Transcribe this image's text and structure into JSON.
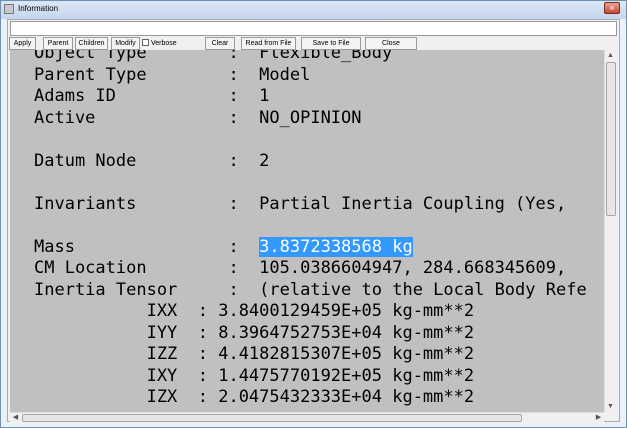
{
  "window": {
    "title": "Information",
    "close_glyph": "×"
  },
  "toolbar": {
    "apply": "Apply",
    "parent": "Parent",
    "children": "Children",
    "modify": "Modify",
    "verbose": "Verbose",
    "clear": "Clear",
    "read_from_file": "Read from File",
    "save_to_file": "Save to File",
    "close": "Close"
  },
  "output": {
    "object_type": "Object Type        :  Flexible_Body",
    "parent_type": "Parent Type        :  Model",
    "adams_id": "Adams ID           :  1",
    "active": "Active             :  NO_OPINION",
    "datum_node": "Datum Node         :  2",
    "invariants": "Invariants         :  Partial Inertia Coupling (Yes,",
    "mass_label": "Mass               :  ",
    "mass_value": "3.8372338568 kg",
    "cm_location": "CM Location        :  105.0386604947, 284.668345609,",
    "inertia_tensor": "Inertia Tensor     :  (relative to the Local Body Refe",
    "ixx": "           IXX  : 3.8400129459E+05 kg-mm**2",
    "iyy": "           IYY  : 8.3964752753E+04 kg-mm**2",
    "izz": "           IZZ  : 4.4182815307E+05 kg-mm**2",
    "ixy": "           IXY  : 1.4475770192E+05 kg-mm**2",
    "izx": "           IZX  : 2.0475432333E+04 kg-mm**2"
  },
  "icons": [
    "app-icon",
    "close-icon",
    "scroll-up-icon",
    "scroll-down-icon",
    "scroll-left-icon",
    "scroll-right-icon"
  ]
}
